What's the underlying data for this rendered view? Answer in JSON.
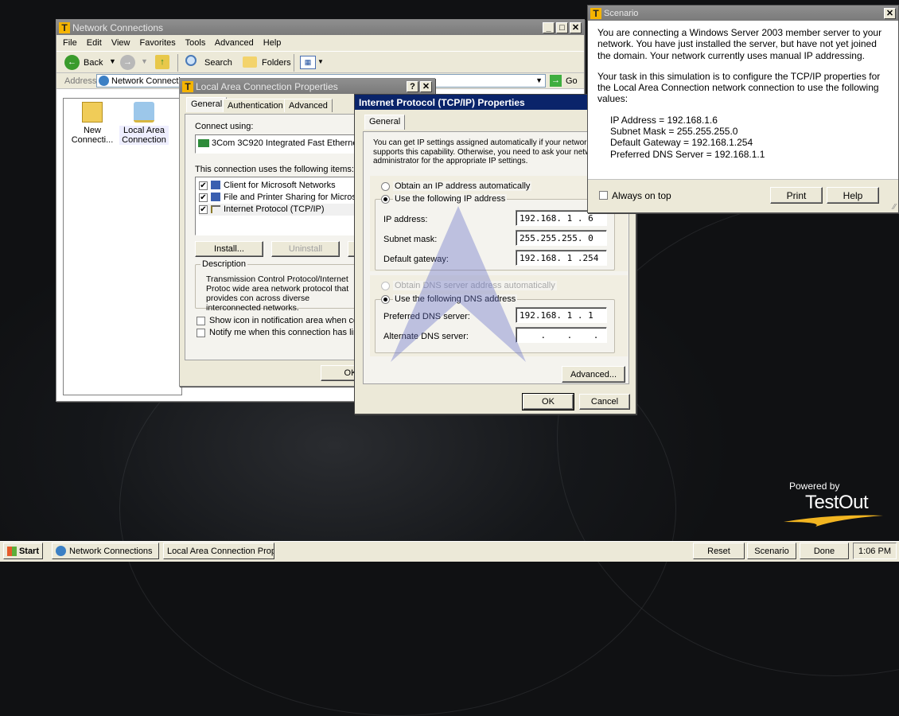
{
  "network_connections": {
    "title": "Network Connections",
    "menu": [
      "File",
      "Edit",
      "View",
      "Favorites",
      "Tools",
      "Advanced",
      "Help"
    ],
    "toolbar": {
      "back": "Back",
      "search": "Search",
      "folders": "Folders"
    },
    "address_label": "Address",
    "address_value": "Network Connections",
    "go_label": "Go",
    "icons": [
      {
        "label_line1": "New",
        "label_line2": "Connecti..."
      },
      {
        "label_line1": "Local Area",
        "label_line2": "Connection"
      }
    ]
  },
  "lac_properties": {
    "title": "Local Area Connection Properties",
    "tabs": [
      "General",
      "Authentication",
      "Advanced"
    ],
    "connect_using_label": "Connect using:",
    "adapter": "3Com 3C920 Integrated Fast Ethernet Con...",
    "items_label": "This connection uses the following items:",
    "items": [
      {
        "label": "Client for Microsoft Networks",
        "checked": true
      },
      {
        "label": "File and Printer Sharing for Microsoft Net",
        "checked": true
      },
      {
        "label": "Internet Protocol (TCP/IP)",
        "checked": true
      }
    ],
    "install_label": "Install...",
    "uninstall_label": "Uninstall",
    "description_title": "Description",
    "description_text": "Transmission Control Protocol/Internet Protoc wide area network protocol that provides con across diverse interconnected networks.",
    "show_icon_label": "Show icon in notification area when connect",
    "notify_label": "Notify me when this connection has limited o",
    "ok_label": "OK"
  },
  "tcpip": {
    "title": "Internet Protocol (TCP/IP) Properties",
    "tab": "General",
    "intro": "You can get IP settings assigned automatically if your network supports this capability.  Otherwise, you need to ask your network administrator for the appropriate IP settings.",
    "obtain_ip_auto": "Obtain an IP address automatically",
    "use_following_ip": "Use the following IP address",
    "ip_label": "IP address:",
    "ip_value": "192.168. 1 . 6",
    "subnet_label": "Subnet mask:",
    "subnet_value": "255.255.255. 0",
    "gateway_label": "Default gateway:",
    "gateway_value": "192.168. 1 .254",
    "obtain_dns_auto": "Obtain DNS server address automatically",
    "use_following_dns": "Use the following DNS address",
    "pref_dns_label": "Preferred DNS server:",
    "pref_dns_value": "192.168. 1 . 1",
    "alt_dns_label": "Alternate DNS server:",
    "alt_dns_value": "    .    .    .",
    "advanced_label": "Advanced...",
    "ok_label": "OK",
    "cancel_label": "Cancel"
  },
  "scenario": {
    "title": "Scenario",
    "para1": "You are connecting a Windows Server 2003 member server to your network. You have just installed the server, but have not yet joined the domain. Your network currently uses manual IP addressing.",
    "para2": "Your task in this simulation is to configure the TCP/IP properties for the Local Area Connection network connection to use the following values:",
    "values": [
      "IP Address = 192.168.1.6",
      "Subnet Mask = 255.255.255.0",
      "Default Gateway = 192.168.1.254",
      "Preferred DNS Server = 192.168.1.1"
    ],
    "ontop_label": "Always on top",
    "print_label": "Print",
    "help_label": "Help"
  },
  "branding": {
    "powered_by": "Powered by",
    "brand": "TestOut"
  },
  "taskbar": {
    "start": "Start",
    "tasks": [
      "Network Connections",
      "Local Area Connection Properties"
    ],
    "reset": "Reset",
    "scenario": "Scenario",
    "done": "Done",
    "clock": "1:06 PM"
  }
}
